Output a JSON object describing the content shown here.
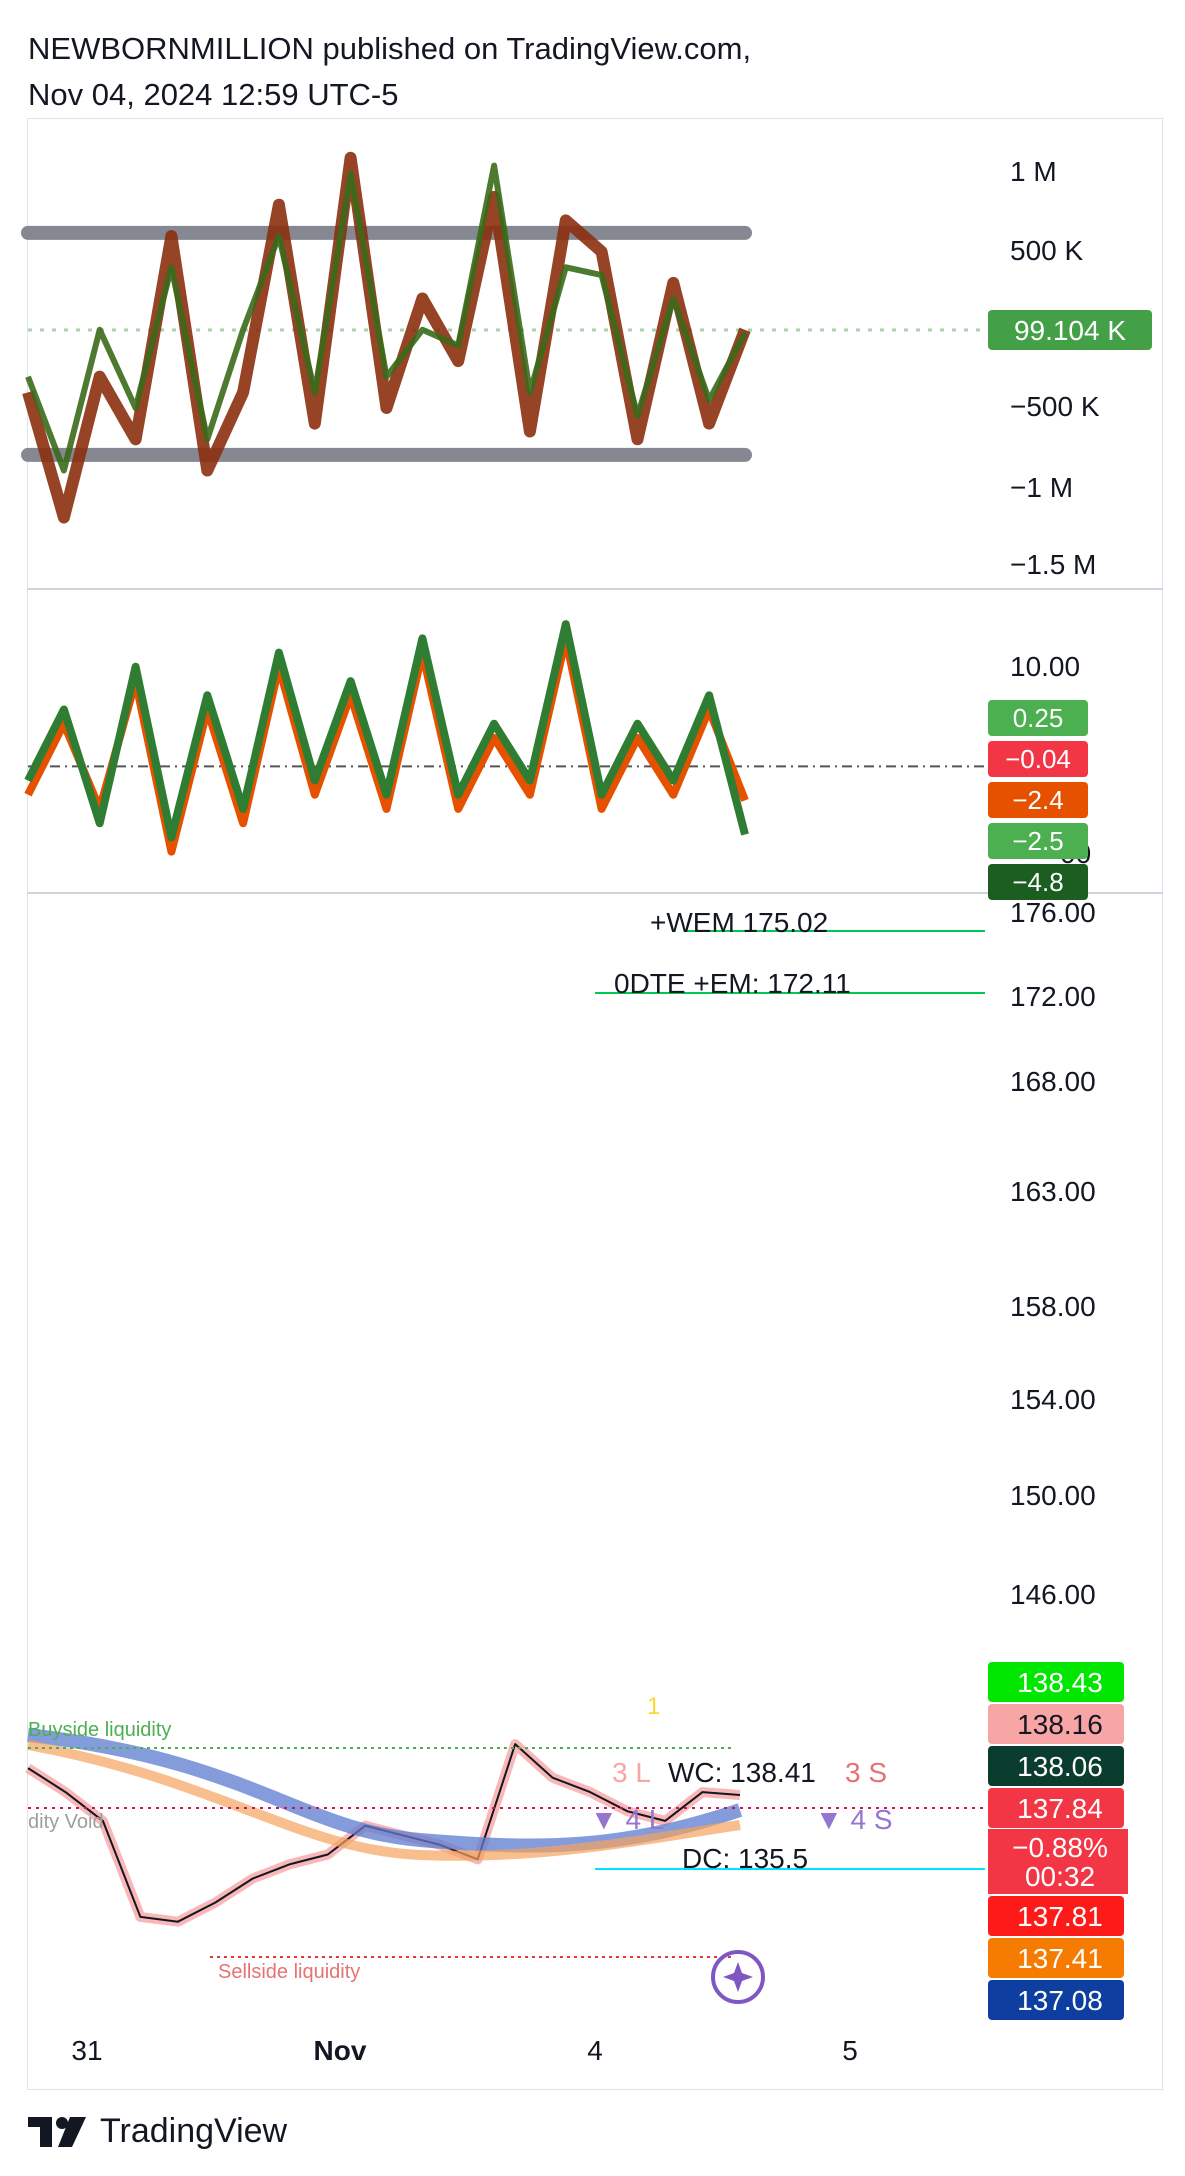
{
  "header": {
    "line1": "NEWBORNMILLION published on TradingView.com,",
    "line2": "Nov 04, 2024 12:59 UTC-5"
  },
  "footer": {
    "brand": "TradingView",
    "logo_icon": "tradingview-logo-icon"
  },
  "colors": {
    "green_tag": "#43a047",
    "red_tag": "#f23645",
    "orange": "#f57c00",
    "dark_green": "#1b5e20",
    "navy": "#0d47a1",
    "purple": "#7e57c2",
    "gray_band": "#787b86",
    "pink": "#f8a5a5",
    "bright_green": "#00e676"
  },
  "chart_data": [
    {
      "type": "line",
      "panel": "volume-delta-oscillator",
      "title": "",
      "y_ticks": [
        "1 M",
        "500 K",
        "−500 K",
        "−1 M",
        "−1.5 M"
      ],
      "ylim": [
        -1500000,
        1250000
      ],
      "bands": [
        720000,
        -700000
      ],
      "last_value_label": "99.104 K",
      "last_value": 99104,
      "series": [
        {
          "color": "#8b2f0e",
          "values": [
            -300000,
            -1100000,
            -200000,
            -600000,
            700000,
            -800000,
            -300000,
            900000,
            -500000,
            1200000,
            -400000,
            300000,
            -100000,
            950000,
            -550000,
            800000,
            600000,
            -600000,
            400000,
            -500000,
            100000
          ]
        },
        {
          "color": "#3a6b1a",
          "values": [
            -200000,
            -800000,
            100000,
            -400000,
            500000,
            -600000,
            100000,
            700000,
            -300000,
            1100000,
            -200000,
            100000,
            0,
            1150000,
            -300000,
            500000,
            450000,
            -450000,
            300000,
            -350000,
            80000
          ]
        }
      ]
    },
    {
      "type": "line",
      "panel": "momentum-oscillator",
      "title": "",
      "y_ticks": [
        "10.00",
        "00"
      ],
      "ylim": [
        -8,
        11
      ],
      "value_labels": [
        {
          "text": "0.25",
          "color": "#4caf50"
        },
        {
          "text": "−0.04",
          "color": "#f23645"
        },
        {
          "text": "−2.4",
          "color": "#e65100"
        },
        {
          "text": "−2.5",
          "color": "#4caf50"
        },
        {
          "text": "−4.8",
          "color": "#1b5e20"
        }
      ],
      "series": [
        {
          "color": "#e65100",
          "values": [
            -2,
            3,
            -3,
            6,
            -6,
            4,
            -4,
            7,
            -2,
            5,
            -3,
            8,
            -3,
            2,
            -2,
            9,
            -3,
            2,
            -2,
            4,
            -2.4
          ]
        },
        {
          "color": "#2e7d32",
          "values": [
            -1,
            4,
            -4,
            7,
            -5,
            5,
            -3,
            8,
            -1,
            6,
            -2,
            9,
            -2,
            3,
            -1,
            10,
            -2,
            3,
            -1,
            5,
            -4.8
          ]
        }
      ]
    },
    {
      "type": "line",
      "panel": "price",
      "title": "",
      "y_ticks": [
        "176.00",
        "172.00",
        "168.00",
        "163.00",
        "158.00",
        "154.00",
        "150.00",
        "146.00"
      ],
      "ylim": [
        134.2,
        177
      ],
      "x_ticks": [
        "31",
        "Nov",
        "4",
        "5"
      ],
      "annotations": [
        "+WEM 175.02",
        "0DTE +EM: 172.11",
        "WC: 138.41",
        "DC: 135.5",
        "Buyside liquidity",
        "Sellside liquidity",
        "dity Void",
        "1",
        "3 L",
        "3 S",
        "4 L",
        "4 S"
      ],
      "price_labels": [
        {
          "text": "138.43",
          "color": "#00e600"
        },
        {
          "text": "138.16",
          "color": "#f8a5a5"
        },
        {
          "text": "138.06",
          "color": "#0b3d2e"
        },
        {
          "text": "137.84",
          "color": "#f23645"
        },
        {
          "text": "−0.88%",
          "color": "#f23645"
        },
        {
          "text": "00:32",
          "color": "#f23645"
        },
        {
          "text": "137.81",
          "color": "#ff1a1a"
        },
        {
          "text": "137.41",
          "color": "#f57c00"
        },
        {
          "text": "137.08",
          "color": "#0d3ea0"
        }
      ],
      "series": [
        {
          "name": "",
          "values": [
            138.4,
            137.9,
            137.3,
            135.3,
            135.2,
            135.6,
            136.1,
            136.4,
            136.6,
            137.2,
            137.0,
            136.8,
            136.5,
            138.9,
            138.2,
            137.9,
            137.5,
            137.3,
            137.9,
            137.84
          ]
        }
      ]
    }
  ]
}
